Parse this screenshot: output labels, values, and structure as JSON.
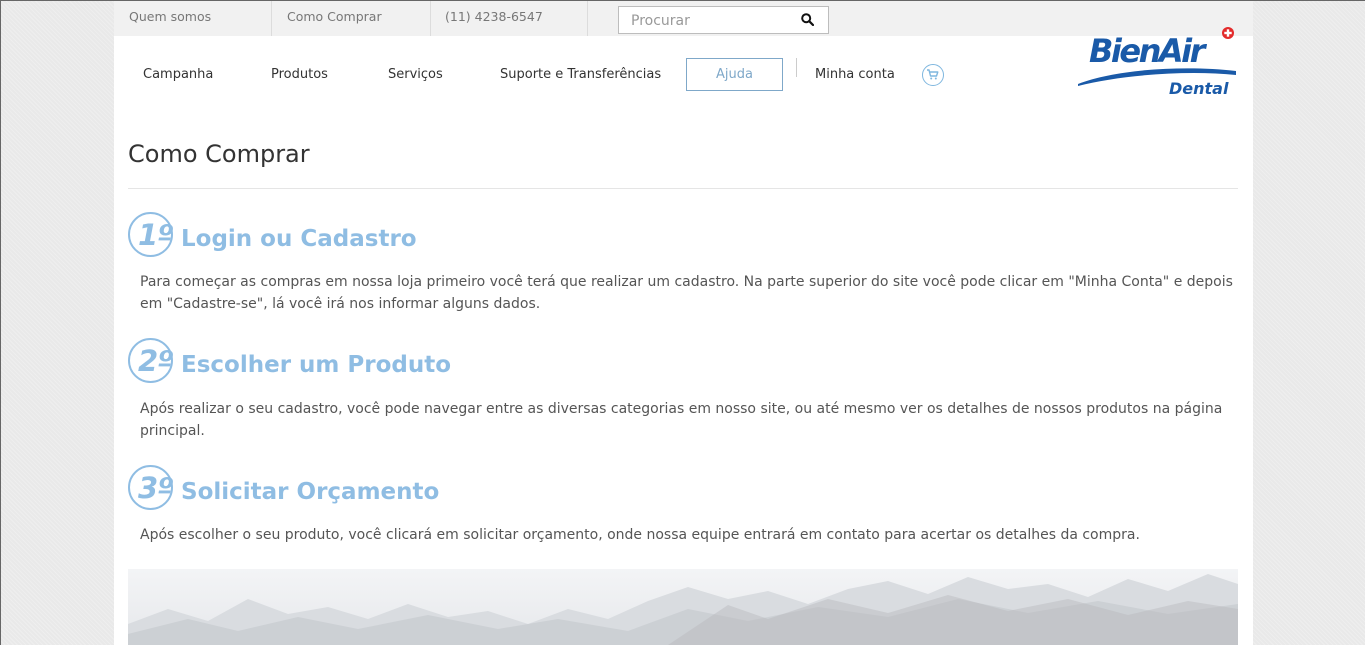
{
  "topbar": {
    "links": [
      {
        "label": "Quem somos"
      },
      {
        "label": "Como Comprar"
      },
      {
        "label": "(11) 4238-6547"
      }
    ],
    "search_placeholder": "Procurar"
  },
  "nav": {
    "items": [
      {
        "label": "Campanha"
      },
      {
        "label": "Produtos"
      },
      {
        "label": "Serviços"
      },
      {
        "label": "Suporte e Transferências"
      },
      {
        "label": "Ajuda"
      },
      {
        "label": "Minha conta"
      }
    ]
  },
  "logo": {
    "brand": "BienAir",
    "sub": "Dental"
  },
  "page": {
    "title": "Como Comprar",
    "steps": [
      {
        "number": "1º",
        "title": "Login ou Cadastro",
        "text": "Para começar as compras em nossa loja primeiro você terá que realizar um cadastro. Na parte superior do site você pode clicar em \"Minha Conta\" e depois em \"Cadastre-se\", lá você irá nos informar alguns dados."
      },
      {
        "number": "2º",
        "title": "Escolher um Produto",
        "text": "Após realizar o seu cadastro, você pode navegar entre as diversas categorias em nosso site, ou até mesmo ver os detalhes de nossos produtos na página principal."
      },
      {
        "number": "3º",
        "title": "Solicitar Orçamento",
        "text": "Após escolher o seu produto, você clicará em solicitar orçamento, onde nossa equipe entrará em contato para acertar os detalhes da compra."
      }
    ]
  },
  "colors": {
    "accent": "#8fbde3",
    "brand_blue": "#1a5aa8",
    "brand_red": "#e32b2b"
  },
  "icons": {
    "search": "search-icon",
    "cart": "cart-icon",
    "swiss_cross": "swiss-cross-icon"
  }
}
